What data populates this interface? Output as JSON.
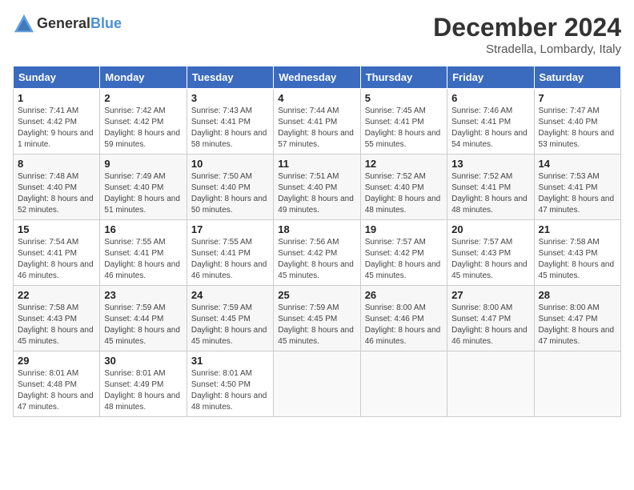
{
  "header": {
    "logo_general": "General",
    "logo_blue": "Blue",
    "month_title": "December 2024",
    "subtitle": "Stradella, Lombardy, Italy"
  },
  "days_of_week": [
    "Sunday",
    "Monday",
    "Tuesday",
    "Wednesday",
    "Thursday",
    "Friday",
    "Saturday"
  ],
  "weeks": [
    [
      {
        "day": "1",
        "sunrise": "7:41 AM",
        "sunset": "4:42 PM",
        "daylight": "9 hours and 1 minute."
      },
      {
        "day": "2",
        "sunrise": "7:42 AM",
        "sunset": "4:42 PM",
        "daylight": "8 hours and 59 minutes."
      },
      {
        "day": "3",
        "sunrise": "7:43 AM",
        "sunset": "4:41 PM",
        "daylight": "8 hours and 58 minutes."
      },
      {
        "day": "4",
        "sunrise": "7:44 AM",
        "sunset": "4:41 PM",
        "daylight": "8 hours and 57 minutes."
      },
      {
        "day": "5",
        "sunrise": "7:45 AM",
        "sunset": "4:41 PM",
        "daylight": "8 hours and 55 minutes."
      },
      {
        "day": "6",
        "sunrise": "7:46 AM",
        "sunset": "4:41 PM",
        "daylight": "8 hours and 54 minutes."
      },
      {
        "day": "7",
        "sunrise": "7:47 AM",
        "sunset": "4:40 PM",
        "daylight": "8 hours and 53 minutes."
      }
    ],
    [
      {
        "day": "8",
        "sunrise": "7:48 AM",
        "sunset": "4:40 PM",
        "daylight": "8 hours and 52 minutes."
      },
      {
        "day": "9",
        "sunrise": "7:49 AM",
        "sunset": "4:40 PM",
        "daylight": "8 hours and 51 minutes."
      },
      {
        "day": "10",
        "sunrise": "7:50 AM",
        "sunset": "4:40 PM",
        "daylight": "8 hours and 50 minutes."
      },
      {
        "day": "11",
        "sunrise": "7:51 AM",
        "sunset": "4:40 PM",
        "daylight": "8 hours and 49 minutes."
      },
      {
        "day": "12",
        "sunrise": "7:52 AM",
        "sunset": "4:40 PM",
        "daylight": "8 hours and 48 minutes."
      },
      {
        "day": "13",
        "sunrise": "7:52 AM",
        "sunset": "4:41 PM",
        "daylight": "8 hours and 48 minutes."
      },
      {
        "day": "14",
        "sunrise": "7:53 AM",
        "sunset": "4:41 PM",
        "daylight": "8 hours and 47 minutes."
      }
    ],
    [
      {
        "day": "15",
        "sunrise": "7:54 AM",
        "sunset": "4:41 PM",
        "daylight": "8 hours and 46 minutes."
      },
      {
        "day": "16",
        "sunrise": "7:55 AM",
        "sunset": "4:41 PM",
        "daylight": "8 hours and 46 minutes."
      },
      {
        "day": "17",
        "sunrise": "7:55 AM",
        "sunset": "4:41 PM",
        "daylight": "8 hours and 46 minutes."
      },
      {
        "day": "18",
        "sunrise": "7:56 AM",
        "sunset": "4:42 PM",
        "daylight": "8 hours and 45 minutes."
      },
      {
        "day": "19",
        "sunrise": "7:57 AM",
        "sunset": "4:42 PM",
        "daylight": "8 hours and 45 minutes."
      },
      {
        "day": "20",
        "sunrise": "7:57 AM",
        "sunset": "4:43 PM",
        "daylight": "8 hours and 45 minutes."
      },
      {
        "day": "21",
        "sunrise": "7:58 AM",
        "sunset": "4:43 PM",
        "daylight": "8 hours and 45 minutes."
      }
    ],
    [
      {
        "day": "22",
        "sunrise": "7:58 AM",
        "sunset": "4:43 PM",
        "daylight": "8 hours and 45 minutes."
      },
      {
        "day": "23",
        "sunrise": "7:59 AM",
        "sunset": "4:44 PM",
        "daylight": "8 hours and 45 minutes."
      },
      {
        "day": "24",
        "sunrise": "7:59 AM",
        "sunset": "4:45 PM",
        "daylight": "8 hours and 45 minutes."
      },
      {
        "day": "25",
        "sunrise": "7:59 AM",
        "sunset": "4:45 PM",
        "daylight": "8 hours and 45 minutes."
      },
      {
        "day": "26",
        "sunrise": "8:00 AM",
        "sunset": "4:46 PM",
        "daylight": "8 hours and 46 minutes."
      },
      {
        "day": "27",
        "sunrise": "8:00 AM",
        "sunset": "4:47 PM",
        "daylight": "8 hours and 46 minutes."
      },
      {
        "day": "28",
        "sunrise": "8:00 AM",
        "sunset": "4:47 PM",
        "daylight": "8 hours and 47 minutes."
      }
    ],
    [
      {
        "day": "29",
        "sunrise": "8:01 AM",
        "sunset": "4:48 PM",
        "daylight": "8 hours and 47 minutes."
      },
      {
        "day": "30",
        "sunrise": "8:01 AM",
        "sunset": "4:49 PM",
        "daylight": "8 hours and 48 minutes."
      },
      {
        "day": "31",
        "sunrise": "8:01 AM",
        "sunset": "4:50 PM",
        "daylight": "8 hours and 48 minutes."
      },
      null,
      null,
      null,
      null
    ]
  ]
}
